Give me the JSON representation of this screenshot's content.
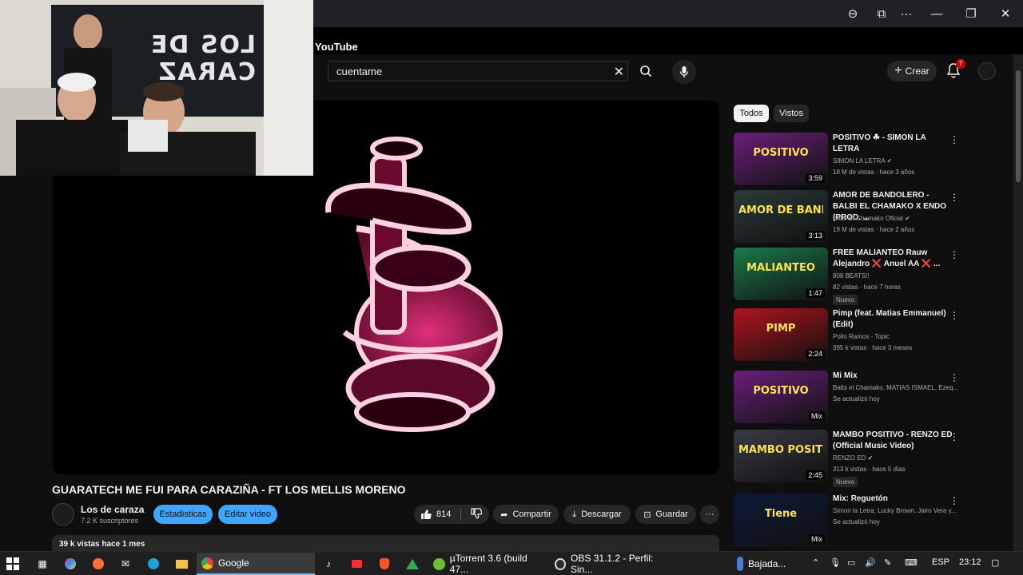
{
  "window": {
    "page_title": "YouTube",
    "controls": {
      "zoom": "⊖",
      "app": "⧉",
      "more": "···",
      "minimize": "—",
      "restore": "❐",
      "close": "✕"
    }
  },
  "header": {
    "search_value": "cuentame",
    "clear_icon": "✕",
    "create_label": "Crear",
    "notifications": "7"
  },
  "player": {
    "title": "GUARATECH ME FUI PARA CARAZIÑA - FT LOS MELLIS MORENO",
    "channel": "Los de caraza",
    "subscribers": "7.2 K suscriptores",
    "stats_btn": "Estadísticas",
    "edit_btn": "Editar video",
    "likes": "814",
    "share": "Compartir",
    "download": "Descargar",
    "save": "Guardar",
    "more": "···",
    "views_line": "39 k vistas  hace 1 mes",
    "webcam_banner": "LOS DE CARAZ"
  },
  "chips": [
    "Todos",
    "Vistos"
  ],
  "recommendations": [
    {
      "title": "POSITIVO ☘ - SIMON LA LETRA",
      "channel": "SIMON LA LETRA ✔",
      "meta": "18 M de vistas · hace 3 años",
      "duration": "3:59",
      "badge": "",
      "thumb_text": "POSITIVO",
      "thumb_color": "#6a1f7a"
    },
    {
      "title": "AMOR DE BANDOLERO - BALBI EL CHAMAKO X ENDO (PROD. ...",
      "channel": "Balbi El Chamako Oficial ✔",
      "meta": "19 M de vistas · hace 2 años",
      "duration": "3:13",
      "badge": "",
      "thumb_text": "AMOR DE BANDOLERO",
      "thumb_color": "#2a3a3a"
    },
    {
      "title": "FREE MALIANTEO Rauw Alejandro ❌ Anuel AA ❌ ...",
      "channel": "808 BEATS!!",
      "meta": "82 vistas · hace 7 horas",
      "duration": "1:47",
      "badge": "Nuevo",
      "thumb_text": "MALIANTEO",
      "thumb_color": "#1a7a4a"
    },
    {
      "title": "Pimp (feat. Matias Emmanuel) (Edit)",
      "channel": "Pollo Ramos - Topic",
      "meta": "395 k vistas · hace 3 meses",
      "duration": "2:24",
      "badge": "",
      "thumb_text": "PIMP",
      "thumb_color": "#b0141e"
    },
    {
      "title": "Mi Mix",
      "channel": "Balbi el Chamako, MATIAS ISMAEL, Ezeq...",
      "meta": "Se actualizó hoy",
      "duration": "Mix",
      "badge": "",
      "thumb_text": "POSITIVO",
      "thumb_color": "#6a1f7a"
    },
    {
      "title": "MAMBO POSITIVO - RENZO ED (Official Music Video)",
      "channel": "RENZO ED ✔",
      "meta": "313 k vistas · hace 5 días",
      "duration": "2:45",
      "badge": "Nuevo",
      "thumb_text": "MAMBO POSITIVO",
      "thumb_color": "#3a3a44"
    },
    {
      "title": "Mix: Reguetón",
      "channel": "Simon la Letra, Lucky Brown, Jairo Vera y...",
      "meta": "Se actualizó hoy",
      "duration": "Mix",
      "badge": "",
      "thumb_text": "Tiene",
      "thumb_color": "#0c1a3a"
    }
  ],
  "taskbar": {
    "apps": [
      {
        "label": "Google"
      },
      {
        "label": "µTorrent 3.6  (build 47..."
      },
      {
        "label": "OBS 31.1.2 - Perfil: Sin..."
      },
      {
        "label": "Bajada..."
      }
    ],
    "lang": "ESP",
    "time": "23:12"
  },
  "colors": {
    "accent_blue": "#3ea6ff",
    "yt_red": "#cc0000",
    "bg": "#0f0f0f"
  }
}
